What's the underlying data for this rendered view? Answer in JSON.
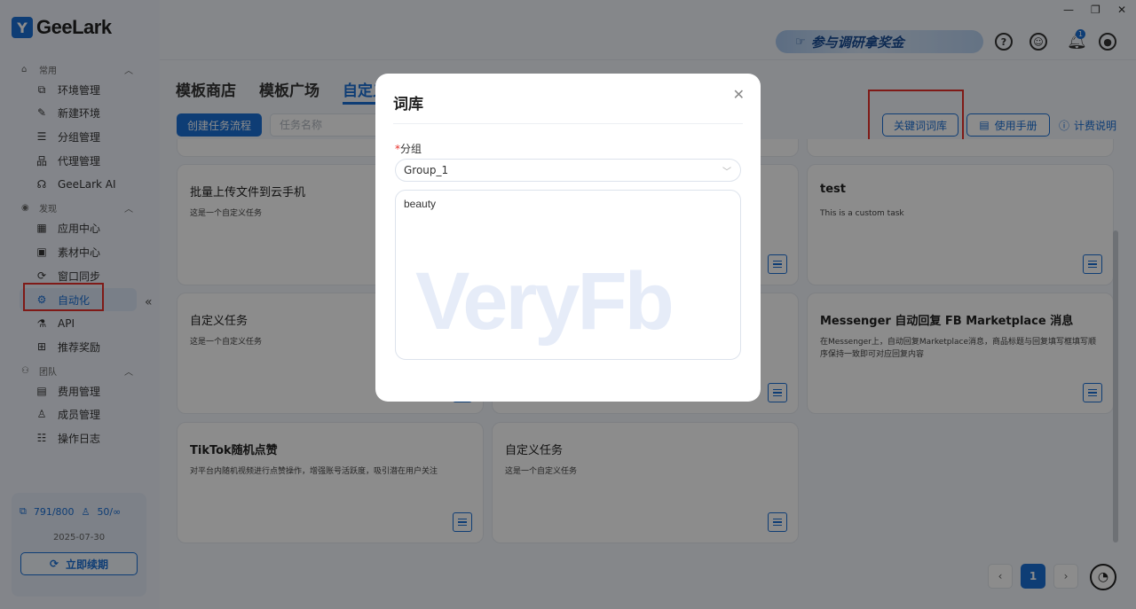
{
  "app": {
    "logo_text": "GeeLark"
  },
  "sidebar": {
    "sections": [
      {
        "label": "常用"
      },
      {
        "label": "发现"
      },
      {
        "label": "团队"
      }
    ],
    "items": [
      {
        "label": "环境管理",
        "icon": "window-icon"
      },
      {
        "label": "新建环境",
        "icon": "edit-icon"
      },
      {
        "label": "分组管理",
        "icon": "list-icon"
      },
      {
        "label": "代理管理",
        "icon": "network-icon"
      },
      {
        "label": "GeeLark AI",
        "icon": "ai-icon"
      },
      {
        "label": "应用中心",
        "icon": "grid-icon"
      },
      {
        "label": "素材中心",
        "icon": "image-icon"
      },
      {
        "label": "窗口同步",
        "icon": "sync-icon"
      },
      {
        "label": "自动化",
        "icon": "robot-icon"
      },
      {
        "label": "API",
        "icon": "api-icon"
      },
      {
        "label": "推荐奖励",
        "icon": "gift-icon"
      },
      {
        "label": "费用管理",
        "icon": "billing-icon"
      },
      {
        "label": "成员管理",
        "icon": "user-icon"
      },
      {
        "label": "操作日志",
        "icon": "log-icon"
      }
    ],
    "quota": {
      "devices": "791/800",
      "members": "50/∞",
      "date": "2025-07-30",
      "renew_label": "立即续期"
    }
  },
  "topbar": {
    "promo_text": "参与调研拿奖金"
  },
  "main": {
    "tabs": [
      "模板商店",
      "模板广场",
      "自定义"
    ],
    "create_button": "创建任务流程",
    "search_placeholder": "任务名称",
    "keyword_button": "关键词词库",
    "manual_button": "使用手册",
    "billing_link": "计费说明",
    "cards": [
      {
        "title": "批量上传文件到云手机",
        "desc": "这是一个自定义任务"
      },
      {
        "title": "test",
        "desc": "This is a custom task"
      },
      {
        "title": "自定义任务",
        "desc": "这是一个自定义任务"
      },
      {
        "title": "Messenger 自动回复 FB Marketplace 消息",
        "desc": "在Messenger上，自动回复Marketplace消息，商品标题与回复填写框填写顺序保持一致即可对应回复内容"
      },
      {
        "title": "TikTok随机点赞",
        "desc": "对平台内随机视频进行点赞操作，增强账号活跃度，吸引潜在用户关注"
      },
      {
        "title": "自定义任务",
        "desc": "这是一个自定义任务"
      }
    ],
    "pagination": {
      "current": "1"
    }
  },
  "modal": {
    "title": "词库",
    "group_label": "分组",
    "group_value": "Group_1",
    "keywords": "beauty",
    "watermark": "VeryFb"
  }
}
